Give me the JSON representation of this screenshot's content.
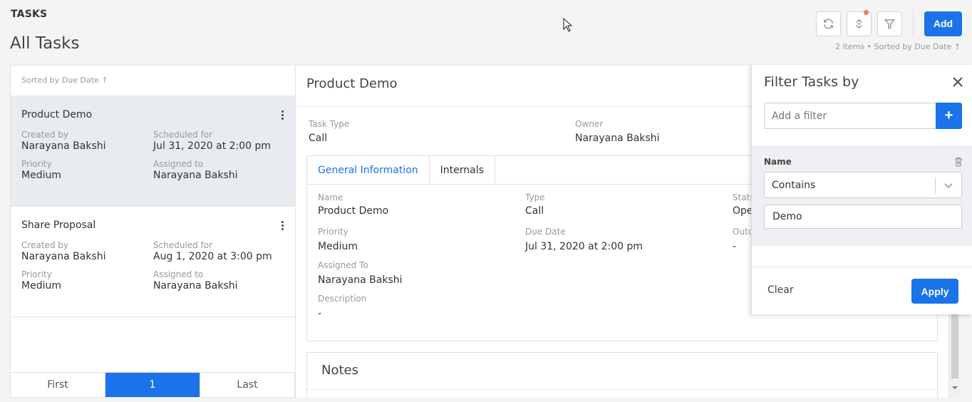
{
  "app_label": "TASKS",
  "page_title": "All Tasks",
  "toolbar": {
    "refresh_icon": "refresh-icon",
    "sort_icon": "sort-icon",
    "filter_icon": "filter-icon",
    "add_label": "Add",
    "meta": "2 items • Sorted by  Due Date ↑"
  },
  "list": {
    "sorted_by": "Sorted by  Due Date ↑",
    "tasks": [
      {
        "title": "Product Demo",
        "created_by_label": "Created by",
        "created_by": "Narayana Bakshi",
        "scheduled_label": "Scheduled for",
        "scheduled": "Jul 31, 2020 at 2:00 pm",
        "priority_label": "Priority",
        "priority": "Medium",
        "assigned_label": "Assigned to",
        "assigned": "Narayana Bakshi"
      },
      {
        "title": "Share Proposal",
        "created_by_label": "Created by",
        "created_by": "Narayana Bakshi",
        "scheduled_label": "Scheduled for",
        "scheduled": "Aug 1, 2020 at 3:00 pm",
        "priority_label": "Priority",
        "priority": "Medium",
        "assigned_label": "Assigned to",
        "assigned": "Narayana Bakshi"
      }
    ],
    "pager": {
      "first": "First",
      "current": "1",
      "last": "Last"
    }
  },
  "detail": {
    "title": "Product Demo",
    "task_type_label": "Task Type",
    "task_type": "Call",
    "owner_label": "Owner",
    "owner": "Narayana Bakshi",
    "tabs": [
      "General Information",
      "Internals"
    ],
    "general": {
      "name_label": "Name",
      "name": "Product Demo",
      "type_label": "Type",
      "type": "Call",
      "status_label": "Statu",
      "status": "Ope",
      "priority_label": "Priority",
      "priority": "Medium",
      "due_label": "Due Date",
      "due": "Jul 31, 2020 at 2:00 pm",
      "outcome_label": "Outco",
      "outcome": "-",
      "assigned_label": "Assigned To",
      "assigned": "Narayana Bakshi",
      "description_label": "Description",
      "description": "-"
    },
    "notes_title": "Notes"
  },
  "filter_panel": {
    "title": "Filter Tasks by",
    "add_placeholder": "Add a filter",
    "rule_field": "Name",
    "rule_operator": "Contains",
    "rule_value": "Demo",
    "clear_label": "Clear",
    "apply_label": "Apply"
  },
  "colors": {
    "accent": "#1a73e8",
    "notify": "#f07a5a",
    "selected_row": "#e8ebef"
  }
}
